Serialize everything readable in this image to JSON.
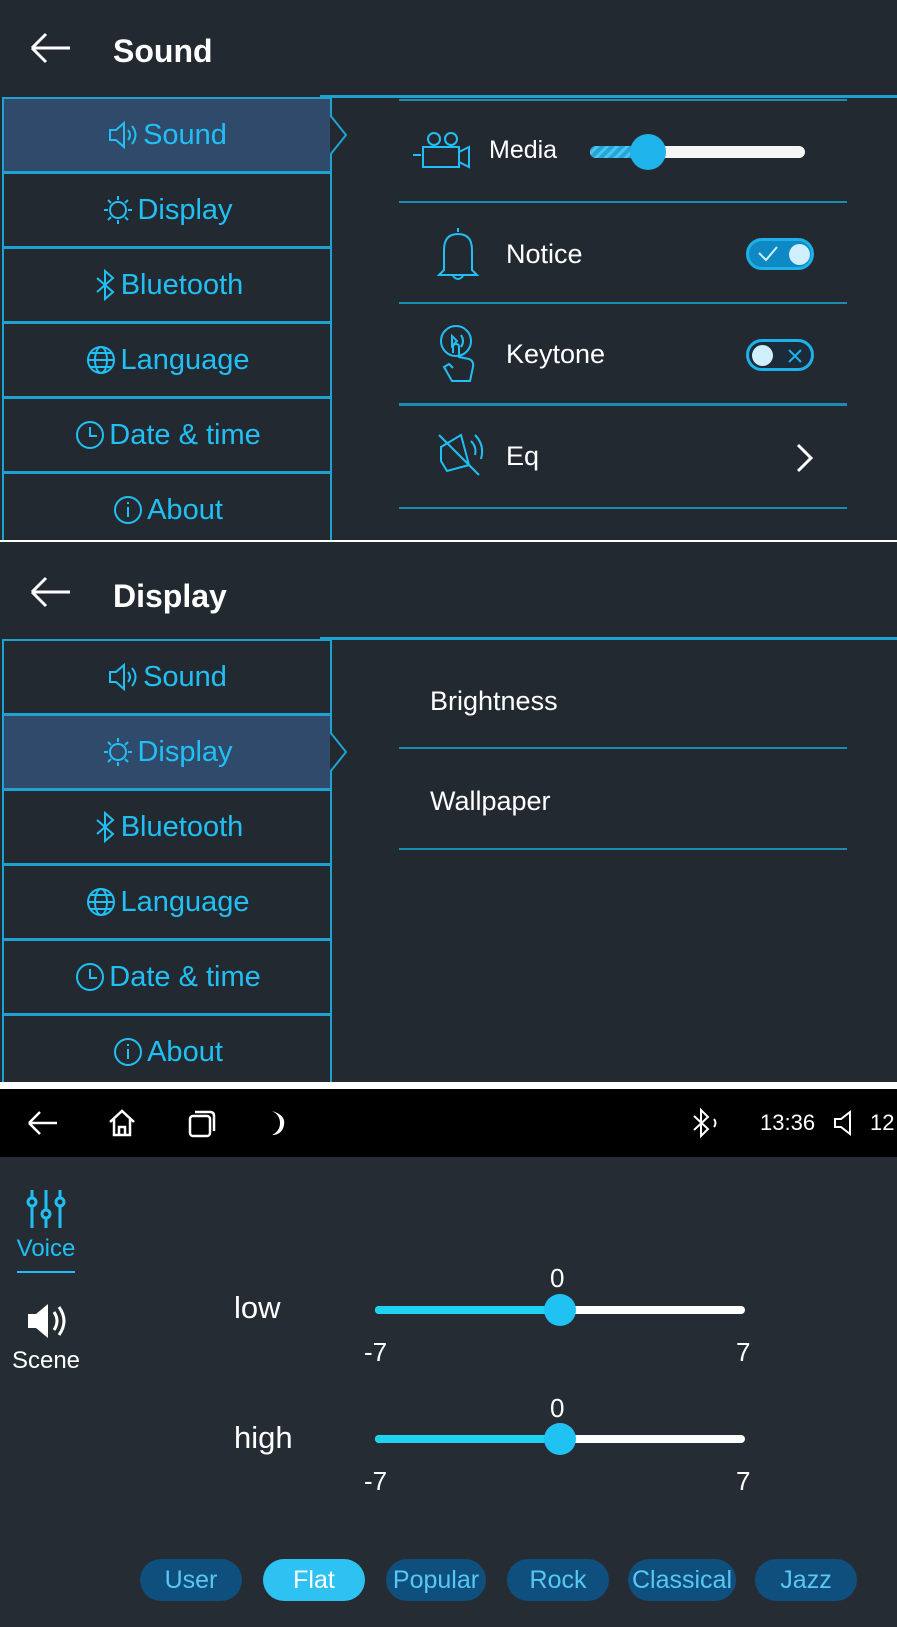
{
  "sound_screen": {
    "title": "Sound",
    "menu": [
      "Sound",
      "Display",
      "Bluetooth",
      "Language",
      "Date & time",
      "About"
    ],
    "active_index": 0,
    "media_label": "Media",
    "media_volume_fraction": 0.27,
    "notice_label": "Notice",
    "notice_on": true,
    "keytone_label": "Keytone",
    "keytone_on": false,
    "eq_label": "Eq"
  },
  "display_screen": {
    "title": "Display",
    "menu": [
      "Sound",
      "Display",
      "Bluetooth",
      "Language",
      "Date & time",
      "About"
    ],
    "active_index": 1,
    "items": [
      "Brightness",
      "Wallpaper"
    ]
  },
  "eq_screen": {
    "status": {
      "time": "13:36",
      "volume": "12"
    },
    "tabs": [
      "Voice",
      "Scene"
    ],
    "active_tab": "Voice",
    "sliders": [
      {
        "label": "low",
        "value": "0",
        "min": "-7",
        "max": "7"
      },
      {
        "label": "high",
        "value": "0",
        "min": "-7",
        "max": "7"
      }
    ],
    "presets": [
      "User",
      "Flat",
      "Popular",
      "Rock",
      "Classical",
      "Jazz"
    ],
    "active_preset": "Flat"
  },
  "colors": {
    "accent": "#20c0f5",
    "background": "#232931",
    "active_menu": "#2f4a6a"
  }
}
